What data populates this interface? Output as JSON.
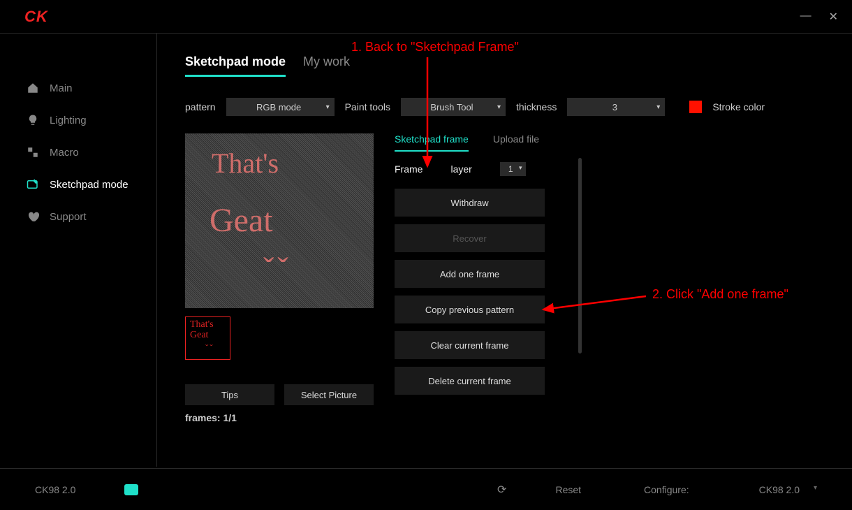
{
  "logo": "CK",
  "nav": {
    "main": "Main",
    "lighting": "Lighting",
    "macro": "Macro",
    "sketchpad": "Sketchpad mode",
    "support": "Support"
  },
  "tabs": {
    "sketchpad": "Sketchpad mode",
    "mywork": "My work"
  },
  "controls": {
    "pattern_label": "pattern",
    "pattern_value": "RGB mode",
    "paint_label": "Paint tools",
    "paint_value": "Brush Tool",
    "thickness_label": "thickness",
    "thickness_value": "3",
    "stroke_label": "Stroke color",
    "stroke_color": "#f10"
  },
  "canvas_text": {
    "line1": "That's",
    "line2": "Geat",
    "line3": "ˇˇ"
  },
  "thumbnails": {
    "t1": "That's\nGeat",
    "t2": "ˇˇ"
  },
  "buttons": {
    "tips": "Tips",
    "select_picture": "Select Picture"
  },
  "frames_label": "frames: 1/1",
  "inner_tabs": {
    "sketchpad_frame": "Sketchpad frame",
    "upload_file": "Upload file"
  },
  "frame_row": {
    "frame": "Frame",
    "layer": "layer",
    "layer_value": "1"
  },
  "ops": {
    "withdraw": "Withdraw",
    "recover": "Recover",
    "add": "Add one frame",
    "copy": "Copy previous pattern",
    "clear": "Clear current frame",
    "delete": "Delete current frame"
  },
  "footer": {
    "model": "CK98 2.0",
    "reset": "Reset",
    "configure": "Configure:",
    "config_value": "CK98 2.0"
  },
  "annotations": {
    "a1": "1. Back to \"Sketchpad Frame\"",
    "a2": "2. Click \"Add one frame\""
  }
}
